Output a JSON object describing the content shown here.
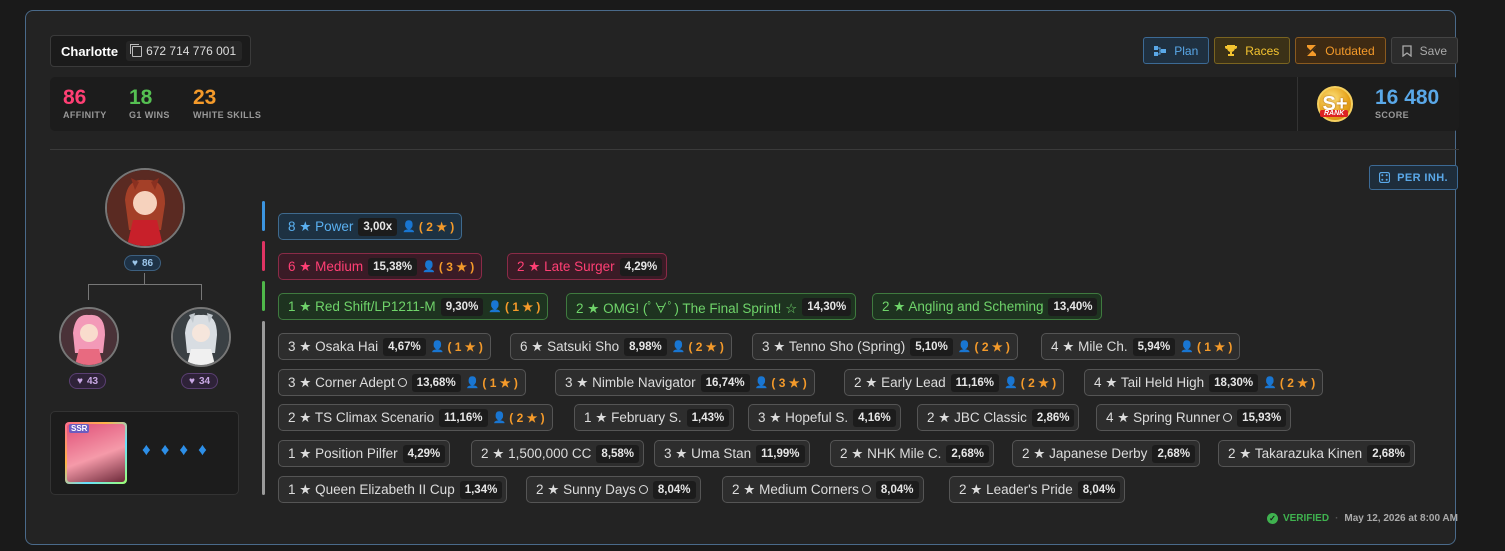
{
  "header": {
    "trainer_name": "Charlotte",
    "trainer_id": "672 714 776 001",
    "buttons": {
      "plan": "Plan",
      "races": "Races",
      "outdated": "Outdated",
      "save": "Save"
    }
  },
  "stats": {
    "affinity": {
      "value": "86",
      "label": "AFFINITY",
      "color": "#ff3f74"
    },
    "g1_wins": {
      "value": "18",
      "label": "G1 WINS",
      "color": "#55c052"
    },
    "white_skills": {
      "value": "23",
      "label": "WHITE SKILLS",
      "color": "#f49a2a"
    },
    "rank": {
      "letter": "S+",
      "tag": "RANK"
    },
    "score": {
      "value": "16 480",
      "label": "SCORE",
      "color": "#5aa8e8"
    }
  },
  "per_inh_label": "PER INH.",
  "lineage": {
    "main_affinity": "86",
    "parent_left_affinity": "43",
    "parent_right_affinity": "34"
  },
  "support": {
    "rarity": "SSR",
    "diamonds": [
      "♦",
      "♦",
      "♦",
      "♦"
    ]
  },
  "sparks": {
    "blue": [
      {
        "label": "8 ★ Power",
        "pct": "3,00x",
        "parent": "( 2 ★ )"
      }
    ],
    "pink": [
      {
        "label": "6 ★ Medium",
        "pct": "15,38%",
        "parent": "( 3 ★ )"
      },
      {
        "label": "2 ★ Late Surger",
        "pct": "4,29%",
        "parent": ""
      }
    ],
    "green": [
      {
        "label": "1 ★ Red Shift/LP1211-M",
        "pct": "9,30%",
        "parent": "( 1 ★ )"
      },
      {
        "label": "2 ★ OMG! (ﾟ∀ﾟ) The Final Sprint! ☆",
        "pct": "14,30%",
        "parent": ""
      },
      {
        "label": "2 ★ Angling and Scheming",
        "pct": "13,40%",
        "parent": ""
      }
    ],
    "white": [
      [
        {
          "label": "3 ★ Osaka Hai",
          "pct": "4,67%",
          "parent": "( 1 ★ )"
        },
        {
          "label": "6 ★ Satsuki Sho",
          "pct": "8,98%",
          "parent": "( 2 ★ )"
        },
        {
          "label": "3 ★ Tenno Sho (Spring)",
          "pct": "5,10%",
          "parent": "( 2 ★ )"
        },
        {
          "label": "4 ★ Mile Ch.",
          "pct": "5,94%",
          "parent": "( 1 ★ )"
        }
      ],
      [
        {
          "label": "3 ★ Corner Adept",
          "pct": "13,68%",
          "parent": "( 1 ★ )",
          "circle": true
        },
        {
          "label": "3 ★ Nimble Navigator",
          "pct": "16,74%",
          "parent": "( 3 ★ )"
        },
        {
          "label": "2 ★ Early Lead",
          "pct": "11,16%",
          "parent": "( 2 ★ )"
        },
        {
          "label": "4 ★ Tail Held High",
          "pct": "18,30%",
          "parent": "( 2 ★ )"
        }
      ],
      [
        {
          "label": "2 ★ TS Climax Scenario",
          "pct": "11,16%",
          "parent": "( 2 ★ )"
        },
        {
          "label": "1 ★ February S.",
          "pct": "1,43%",
          "parent": ""
        },
        {
          "label": "3 ★ Hopeful S.",
          "pct": "4,16%",
          "parent": ""
        },
        {
          "label": "2 ★ JBC Classic",
          "pct": "2,86%",
          "parent": ""
        },
        {
          "label": "4 ★ Spring Runner",
          "pct": "15,93%",
          "parent": "",
          "circle": true
        }
      ],
      [
        {
          "label": "1 ★ Position Pilfer",
          "pct": "4,29%",
          "parent": ""
        },
        {
          "label": "2 ★ 1,500,000 CC",
          "pct": "8,58%",
          "parent": ""
        },
        {
          "label": "3 ★ Uma Stan",
          "pct": "11,99%",
          "parent": ""
        },
        {
          "label": "2 ★ NHK Mile C.",
          "pct": "2,68%",
          "parent": ""
        },
        {
          "label": "2 ★ Japanese Derby",
          "pct": "2,68%",
          "parent": ""
        },
        {
          "label": "2 ★ Takarazuka Kinen",
          "pct": "2,68%",
          "parent": ""
        }
      ],
      [
        {
          "label": "1 ★ Queen Elizabeth II Cup",
          "pct": "1,34%",
          "parent": ""
        },
        {
          "label": "2 ★ Sunny Days",
          "pct": "8,04%",
          "parent": "",
          "circle": true
        },
        {
          "label": "2 ★ Medium Corners",
          "pct": "8,04%",
          "parent": "",
          "circle": true
        },
        {
          "label": "2 ★ Leader's Pride",
          "pct": "8,04%",
          "parent": ""
        }
      ]
    ]
  },
  "footer": {
    "verified": "VERIFIED",
    "date": "May 12, 2026 at 8:00 AM"
  }
}
